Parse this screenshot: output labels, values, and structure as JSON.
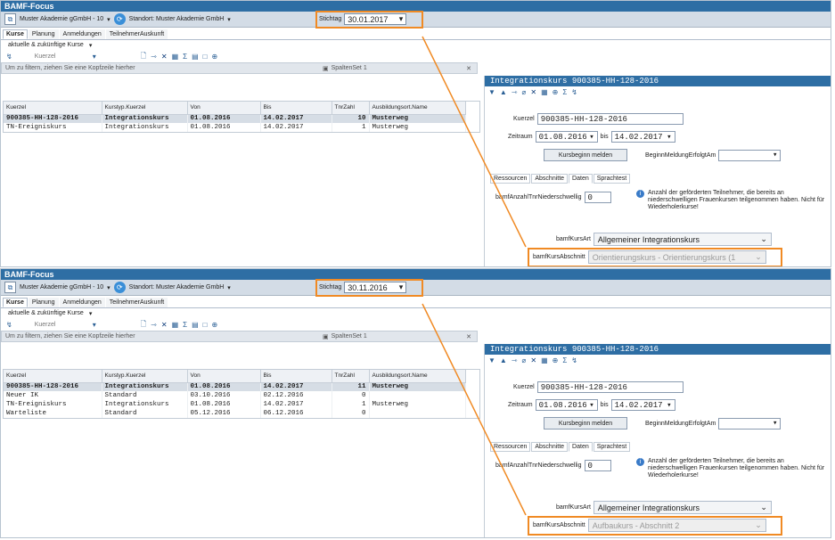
{
  "top": {
    "title": "BAMF-Focus",
    "org": "Muster Akademie gGmbH - 10",
    "standort": "Standort: Muster Akademie GmbH",
    "stichtag_label": "Stichtag",
    "stichtag": "30.01.2017",
    "tabs": [
      "Kurse",
      "Planung",
      "Anmeldungen",
      "TeilnehmerAuskunft"
    ],
    "filter": "aktuelle & zukünftige Kurse",
    "kuerzel_ph": "Kuerzel",
    "group_hint": "Um zu filtern, ziehen Sie eine Kopfzeile hierher",
    "spaltenset": "SpaltenSet 1",
    "columns": [
      "Kuerzel",
      "Kurstyp.Kuerzel",
      "Von",
      "Bis",
      "TnrZahl",
      "Ausbildungsort.Name"
    ],
    "rows": [
      [
        "900385-HH-128-2016",
        "Integrationskurs",
        "01.08.2016",
        "14.02.2017",
        "10",
        "Musterweg"
      ],
      [
        "TN-Ereigniskurs",
        "Integrationskurs",
        "01.08.2016",
        "14.02.2017",
        "1",
        "Musterweg"
      ]
    ],
    "detail_title": "Integrationskurs 900385-HH-128-2016",
    "kuerzel_label": "Kuerzel",
    "kuerzel_val": "900385-HH-128-2016",
    "zeitraum_label": "Zeitraum",
    "von": "01.08.2016",
    "bis_label": "bis",
    "bis": "14.02.2017",
    "kursbeginn_btn": "Kursbeginn melden",
    "beginn_label": "BeginnMeldungErfolgtAm",
    "rtabs": [
      "Ressourcen",
      "Abschnitte",
      "Daten",
      "Sprachtest"
    ],
    "anzahl_label": "bamfAnzahlTnrNiederschwellig",
    "anzahl_val": "0",
    "info": "Anzahl der geförderten Teilnehmer, die bereits an niederschwelligen Frauenkursen teilgenommen haben. Nicht für Wiederholerkurse!",
    "kursart_label": "bamfKursArt",
    "kursart": "Allgemeiner Integrationskurs",
    "abschnitt_label": "bamfKursAbschnitt",
    "abschnitt": "Orientierungskurs - Orientierungskurs (1"
  },
  "bottom": {
    "title": "BAMF-Focus",
    "org": "Muster Akademie gGmbH - 10",
    "standort": "Standort: Muster Akademie GmbH",
    "stichtag_label": "Stichtag",
    "stichtag": "30.11.2016",
    "tabs": [
      "Kurse",
      "Planung",
      "Anmeldungen",
      "TeilnehmerAuskunft"
    ],
    "filter": "aktuelle & zukünftige Kurse",
    "kuerzel_ph": "Kuerzel",
    "group_hint": "Um zu filtern, ziehen Sie eine Kopfzeile hierher",
    "spaltenset": "SpaltenSet 1",
    "columns": [
      "Kuerzel",
      "Kurstyp.Kuerzel",
      "Von",
      "Bis",
      "TnrZahl",
      "Ausbildungsort.Name"
    ],
    "rows": [
      [
        "900385-HH-128-2016",
        "Integrationskurs",
        "01.08.2016",
        "14.02.2017",
        "11",
        "Musterweg"
      ],
      [
        "Neuer IK",
        "Standard",
        "03.10.2016",
        "02.12.2016",
        "0",
        ""
      ],
      [
        "TN-Ereigniskurs",
        "Integrationskurs",
        "01.08.2016",
        "14.02.2017",
        "1",
        "Musterweg"
      ],
      [
        "Warteliste",
        "Standard",
        "05.12.2016",
        "06.12.2016",
        "0",
        ""
      ]
    ],
    "detail_title": "Integrationskurs 900385-HH-128-2016",
    "kuerzel_label": "Kuerzel",
    "kuerzel_val": "900385-HH-128-2016",
    "zeitraum_label": "Zeitraum",
    "von": "01.08.2016",
    "bis_label": "bis",
    "bis": "14.02.2017",
    "kursbeginn_btn": "Kursbeginn melden",
    "beginn_label": "BeginnMeldungErfolgtAm",
    "rtabs": [
      "Ressourcen",
      "Abschnitte",
      "Daten",
      "Sprachtest"
    ],
    "anzahl_label": "bamfAnzahlTnrNiederschwellig",
    "anzahl_val": "0",
    "info": "Anzahl der geförderten Teilnehmer, die bereits an niederschwelligen Frauenkursen teilgenommen haben. Nicht für Wiederholerkurse!",
    "kursart_label": "bamfKursArt",
    "kursart": "Allgemeiner Integrationskurs",
    "abschnitt_label": "bamfKursAbschnitt",
    "abschnitt": "Aufbaukurs - Abschnitt 2"
  },
  "colors": {
    "title_bar": "#2e6ea4",
    "highlight": "#f08a24"
  }
}
